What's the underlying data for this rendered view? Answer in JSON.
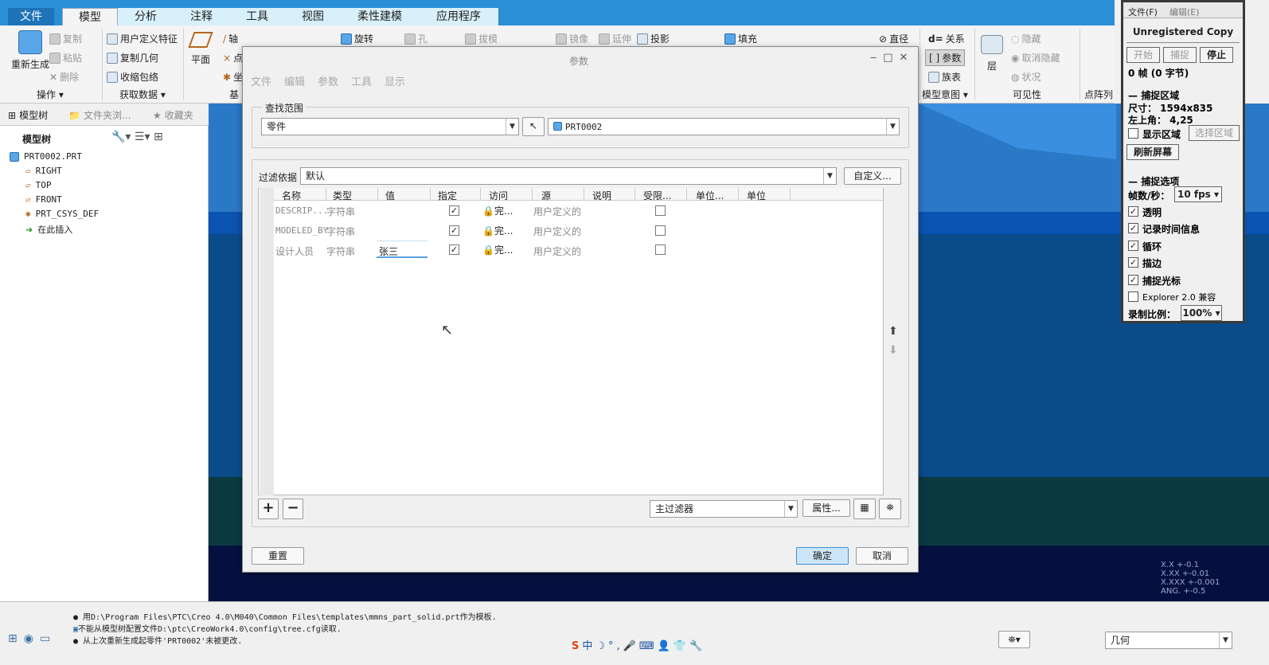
{
  "menubar": {
    "tabs": [
      "文件",
      "模型",
      "分析",
      "注释",
      "工具",
      "视图",
      "柔性建模",
      "应用程序"
    ],
    "active": "模型"
  },
  "ribbon": {
    "regen": "重新生成",
    "copy": "复制",
    "paste": "粘贴",
    "delete": "删除",
    "udf": "用户定义特征",
    "copy_geom": "复制几何",
    "shrinkwrap": "收缩包络",
    "plane": "平面",
    "axis": "轴",
    "point": "点",
    "csys": "坐",
    "revolve": "旋转",
    "hole": "孔",
    "draft": "拔模",
    "mirror": "镜像",
    "extend": "延伸",
    "project": "投影",
    "fill": "填充",
    "diameter": "直径",
    "relations": "关系",
    "params": "参数",
    "family": "族表",
    "layer": "层",
    "hide": "隐藏",
    "unhide": "取消隐藏",
    "status": "状况",
    "groups": {
      "ops": "操作",
      "getdata": "获取数据",
      "datum": "基",
      "intent": "模型意图",
      "visibility": "可见性",
      "pointcloud": "点阵列"
    }
  },
  "leftpanel": {
    "tabs": [
      "模型树",
      "文件夹浏...",
      "收藏夹"
    ],
    "header": "模型树",
    "tree": [
      "PRT0002.PRT",
      "RIGHT",
      "TOP",
      "FRONT",
      "PRT_CSYS_DEF",
      "在此插入"
    ]
  },
  "dialog": {
    "title": "参数",
    "menu": [
      "文件",
      "编辑",
      "参数",
      "工具",
      "显示"
    ],
    "scope_label": "查找范围",
    "scope_type": "零件",
    "scope_object": "PRT0002",
    "filter_label": "过滤依据",
    "filter_value": "默认",
    "customize": "自定义...",
    "columns": [
      "名称",
      "类型",
      "值",
      "指定",
      "访问",
      "源",
      "说明",
      "受限...",
      "单位...",
      "单位"
    ],
    "rows": [
      {
        "name": "DESCRIP...",
        "type": "字符串",
        "value": "",
        "designated": true,
        "access": "完...",
        "source": "用户定义的",
        "restricted": false
      },
      {
        "name": "MODELED_BY",
        "type": "字符串",
        "value": "",
        "designated": true,
        "access": "完...",
        "source": "用户定义的",
        "restricted": false
      },
      {
        "name": "设计人员",
        "type": "字符串",
        "value": "张三",
        "designated": true,
        "access": "完...",
        "source": "用户定义的",
        "restricted": false
      }
    ],
    "add": "+",
    "remove": "−",
    "main_filter": "主过滤器",
    "properties": "属性...",
    "reset": "重置",
    "ok": "确定",
    "cancel": "取消"
  },
  "viewport": {
    "tolerances": [
      "X.X +-0.1",
      "X.XX +-0.01",
      "X.XXX +-0.001",
      "ANG. +-0.5"
    ]
  },
  "status": {
    "messages": [
      "● 用D:\\Program Files\\PTC\\Creo 4.0\\M040\\Common Files\\templates\\mmns_part_solid.prt作为模板.",
      "不能从模型树配置文件D:\\ptc\\CreoWork4.0\\config\\tree.cfg读取.",
      "● 从上次重新生成起零件'PRT0002'未被更改."
    ],
    "filter": "几何"
  },
  "capture": {
    "menu": [
      "文件(F)",
      "编辑(E)"
    ],
    "title": "Unregistered Copy",
    "start": "开始",
    "capture": "捕捉",
    "stop": "停止",
    "frames": "0 帧 (0 字节)",
    "region_head": "捕捉区域",
    "size": "尺寸： 1594x835",
    "topleft": "左上角： 4,25",
    "show_region": "显示区域",
    "select_region": "选择区域",
    "refresh": "刷新屏幕",
    "options_head": "捕捉选项",
    "fps_label": "帧数/秒：",
    "fps": "10 fps",
    "opts": [
      "透明",
      "记录时间信息",
      "循环",
      "描边",
      "捕捉光标",
      "Explorer 2.0 兼容"
    ],
    "opts_checked": [
      true,
      true,
      true,
      true,
      true,
      false
    ],
    "scale_label": "录制比例：",
    "scale": "100%"
  }
}
